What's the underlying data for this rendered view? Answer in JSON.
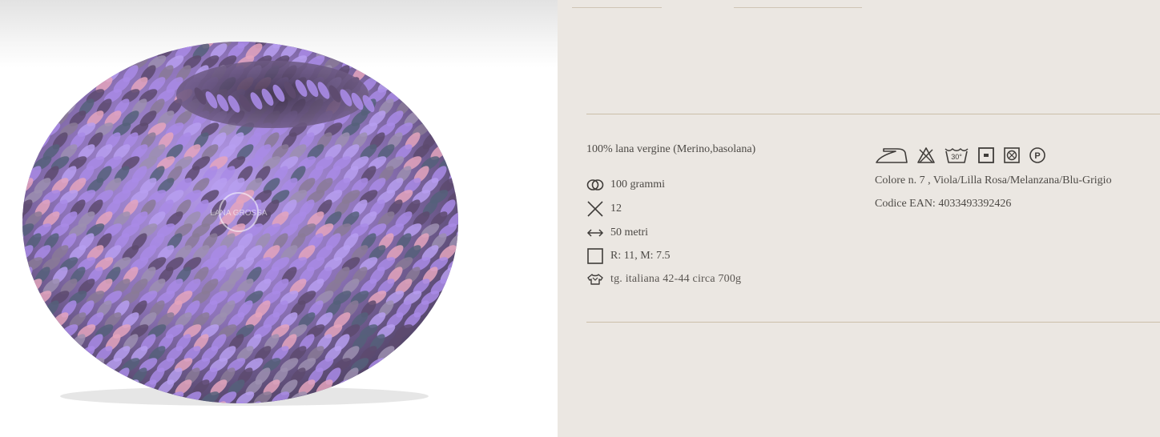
{
  "product": {
    "image_alt": "Gomitolo di lana viola, lilla, rosa, melanzana e blu-grigio",
    "watermark": "LANA GROSSA"
  },
  "tabs": [
    {
      "label": ""
    },
    {
      "label": ""
    }
  ],
  "details": {
    "composition": "100% lana vergine (Merino,basolana)",
    "specs": [
      {
        "icon": "weight-icon",
        "text": "100 grammi"
      },
      {
        "icon": "needle-size-icon",
        "text": "12"
      },
      {
        "icon": "length-icon",
        "text": "50 metri"
      },
      {
        "icon": "gauge-square-icon",
        "text": "R: 11, M: 7.5"
      },
      {
        "icon": "sweater-icon",
        "text": "tg. italiana  42-44 circa  700g"
      }
    ],
    "care_symbols": [
      "iron-icon",
      "no-bleach-icon",
      "wash-30-icon",
      "tumble-dry-no-icon",
      "dry-clean-no-icon",
      "professional-clean-p-icon"
    ],
    "wash_temp": "30°",
    "professional_letter": "P",
    "color": "Colore n. 7 , Viola/Lilla Rosa/Melanzana/Blu-Grigio",
    "ean": "Codice EAN: 4033493392426"
  },
  "colors": {
    "panel_bg": "#ebe7e2",
    "divider": "#cbbfa9",
    "text": "#4d4a46",
    "yarn_lilac": "#a98be6",
    "yarn_purple_dark": "#5d4a6e",
    "yarn_slate": "#55607a",
    "yarn_pink": "#e4a4bd"
  }
}
